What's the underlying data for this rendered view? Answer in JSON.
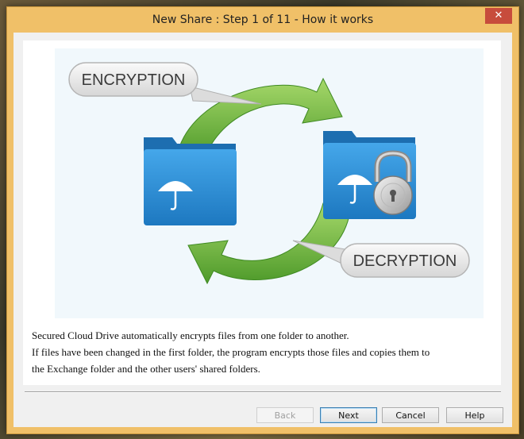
{
  "window": {
    "title": "New Share : Step 1 of 11 - How it works",
    "close_symbol": "✕"
  },
  "illustration": {
    "encryption_label": "ENCRYPTION",
    "decryption_label": "DECRYPTION",
    "folder_icon": "folder-umbrella-icon",
    "lock_icon": "padlock-icon",
    "arrow_color": "#6cb83a",
    "folder_color": "#2d8fd6"
  },
  "description": {
    "lines": [
      "Secured Cloud Drive automatically encrypts files from one folder to another.",
      "If files have been changed in the first folder, the program encrypts those files and copies them to",
      "the Exchange folder and the other users' shared folders."
    ]
  },
  "buttons": {
    "back": "Back",
    "next": "Next",
    "cancel": "Cancel",
    "help": "Help"
  }
}
